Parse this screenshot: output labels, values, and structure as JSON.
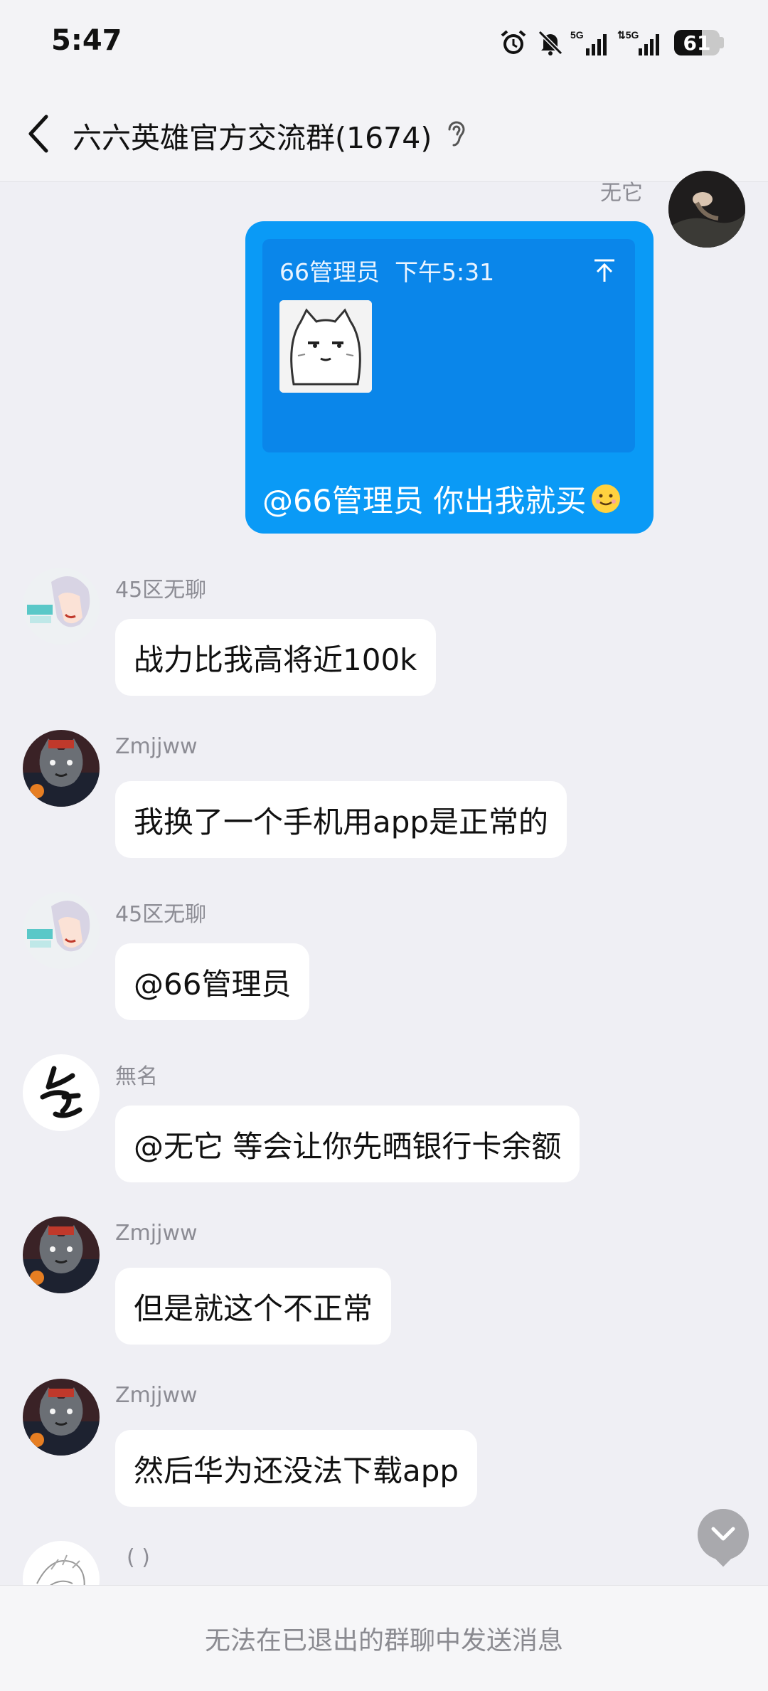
{
  "status_bar": {
    "time": "5:47",
    "battery": "61",
    "battery_level": 0.61,
    "network_1": "5G",
    "network_2": "5G"
  },
  "header": {
    "back_icon": "chevron-left-icon",
    "title": "六六英雄官方交流群(1674)",
    "ear_icon": "ear-icon"
  },
  "my_message": {
    "sender": "无它",
    "quote": {
      "author": "66管理员",
      "time": "下午5:31",
      "pin_icon": "pin-to-top-icon",
      "sticker": "cat-face-sticker"
    },
    "text": "@66管理员 你出我就买",
    "emoji": "smile-emoji"
  },
  "messages": [
    {
      "sender": "45区无聊",
      "text": "战力比我高将近100k",
      "avatar": "anime-avatar"
    },
    {
      "sender": "Zmjjww",
      "text": "我换了一个手机用app是正常的",
      "avatar": "wolf-avatar"
    },
    {
      "sender": "45区无聊",
      "text": "@66管理员",
      "avatar": "anime-avatar"
    },
    {
      "sender": "無名",
      "text": "@无它 等会让你先晒银行卡余额",
      "avatar": "calligraphy-avatar"
    },
    {
      "sender": "Zmjjww",
      "text": "但是就这个不正常",
      "avatar": "wolf-avatar"
    },
    {
      "sender": "Zmjjww",
      "text": "然后华为还没法下载app",
      "avatar": "wolf-avatar"
    }
  ],
  "partial_message": {
    "sender": "( )"
  },
  "footer": {
    "notice": "无法在已退出的群聊中发送消息"
  },
  "colors": {
    "my_bubble": "#0a9af6",
    "background": "#efeff4"
  }
}
